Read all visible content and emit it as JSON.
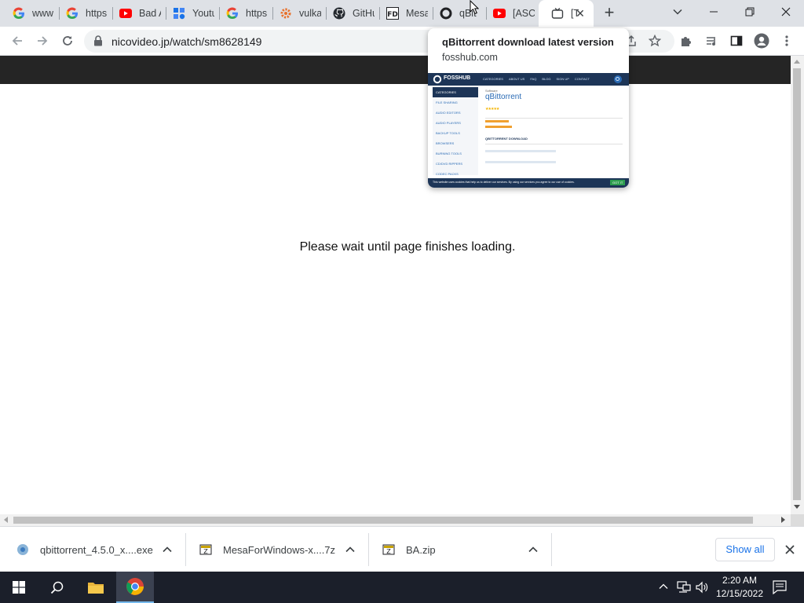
{
  "tabs": [
    {
      "title": "www",
      "icon": "google-icon"
    },
    {
      "title": "https",
      "icon": "google-icon"
    },
    {
      "title": "Bad A",
      "icon": "youtube-icon"
    },
    {
      "title": "Youtu",
      "icon": "puzzle-icon"
    },
    {
      "title": "https",
      "icon": "google-icon"
    },
    {
      "title": "vulka",
      "icon": "gear-icon"
    },
    {
      "title": "GitHu",
      "icon": "github-icon"
    },
    {
      "title": "Mesa",
      "icon": "fd-icon"
    },
    {
      "title": "qBit",
      "icon": "fosshub-icon"
    },
    {
      "title": "[ASC",
      "icon": "youtube-icon"
    },
    {
      "title": "[T",
      "icon": "niconico-icon"
    }
  ],
  "new_tab_label": "+",
  "address": {
    "url": "nicovideo.jp/watch/sm8628149"
  },
  "page": {
    "loading_text": "Please wait until page finishes loading."
  },
  "hovercard": {
    "title": "qBittorrent download latest version",
    "domain": "fosshub.com",
    "preview": {
      "logo": "FOSSHUB",
      "nav": [
        "CATEGORIES",
        "ABOUT US",
        "FAQ",
        "BLOG",
        "SIGN UP",
        "CONTACT"
      ],
      "sidebar": [
        "CATEGORIES",
        "FILE SHARING",
        "AUDIO EDITORS",
        "AUDIO PLAYERS",
        "BACKUP TOOLS",
        "BROWSERS",
        "BURNING TOOLS",
        "CD/DVD RIPPERS",
        "CODEC PACKS"
      ],
      "crumb": "Software",
      "app_title": "qBittorrent",
      "section_title": "QBITTORRENT DOWNLOAD",
      "cookie_text": "This website uses cookies that help us to deliver our services. By using our services you agree to our use of cookies.",
      "cookie_button": "GOT IT"
    }
  },
  "downloads": [
    {
      "name": "qbittorrent_4.5.0_x....exe",
      "icon": "installer-icon"
    },
    {
      "name": "MesaForWindows-x....7z",
      "icon": "archive-icon"
    },
    {
      "name": "BA.zip",
      "icon": "archive-icon"
    }
  ],
  "show_all_label": "Show all",
  "taskbar": {
    "time": "2:20 AM",
    "date": "12/15/2022"
  },
  "colors": {
    "accent": "#1a73e8",
    "page_header": "#252525",
    "taskbar": "#1b1f2a",
    "tabstrip": "#dee1e6"
  }
}
